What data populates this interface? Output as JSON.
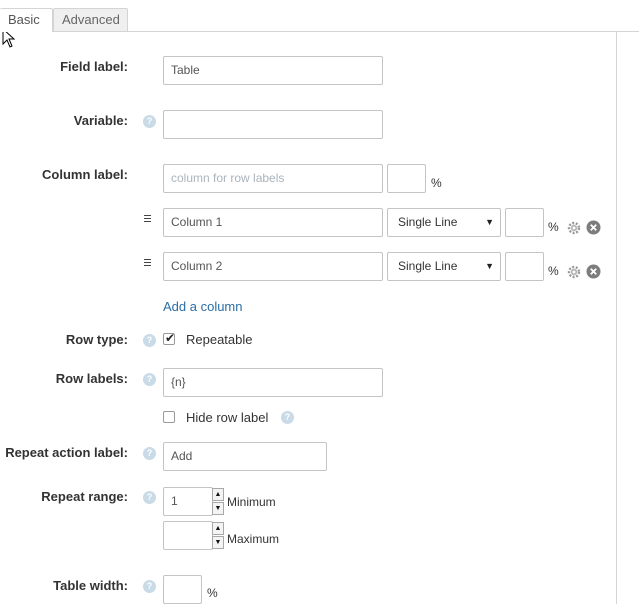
{
  "tabs": [
    {
      "label": "Basic",
      "active": true
    },
    {
      "label": "Advanced",
      "active": false
    }
  ],
  "help_glyph": "?",
  "fields": {
    "field_label": {
      "label": "Field label:",
      "value": "Table"
    },
    "variable": {
      "label": "Variable:",
      "value": ""
    },
    "column_label": {
      "label": "Column label:",
      "placeholder": "column for row labels",
      "width": "",
      "unit": "%"
    },
    "columns": [
      {
        "name": "Column 1",
        "type": "Single Line",
        "width": "",
        "unit": "%"
      },
      {
        "name": "Column 2",
        "type": "Single Line",
        "width": "",
        "unit": "%"
      }
    ],
    "add_column": "Add a column",
    "row_type": {
      "label": "Row type:",
      "option": "Repeatable",
      "checked": true
    },
    "row_labels": {
      "label": "Row labels:",
      "value": "{n}"
    },
    "hide_row_label": {
      "option": "Hide row label",
      "checked": false
    },
    "repeat_action_label": {
      "label": "Repeat action label:",
      "value": "Add"
    },
    "repeat_range": {
      "label": "Repeat range:",
      "min_value": "1",
      "min_label": "Minimum",
      "max_value": "",
      "max_label": "Maximum"
    },
    "table_width": {
      "label": "Table width:",
      "value": "",
      "unit": "%"
    }
  },
  "colors": {
    "link": "#2a6ea6",
    "help": "#c8dbe6",
    "border": "#c4c4c4"
  }
}
